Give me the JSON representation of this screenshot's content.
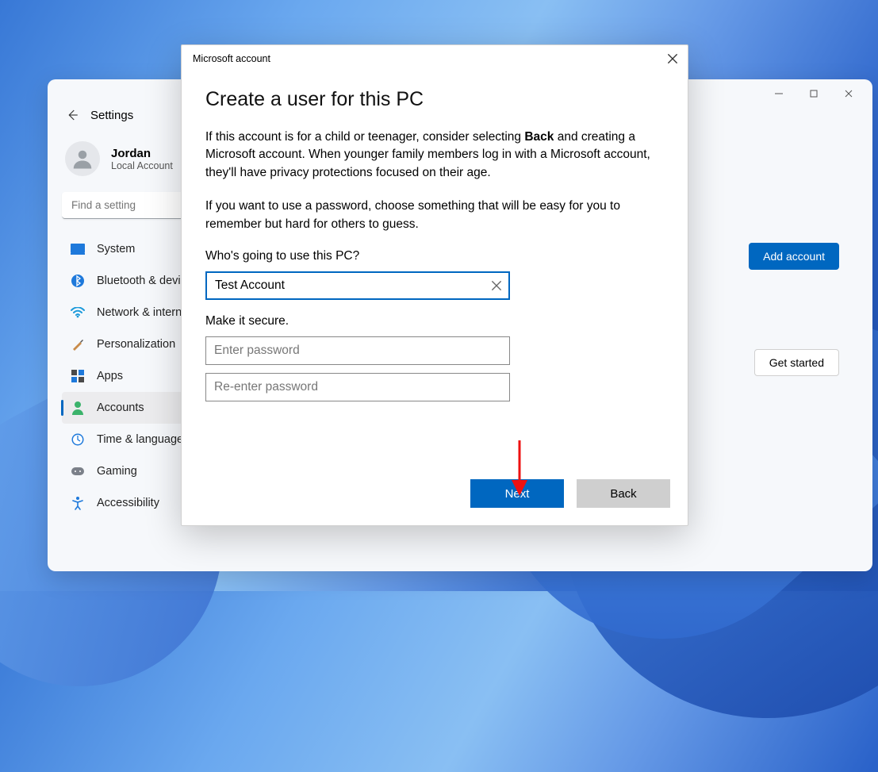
{
  "settings": {
    "header_label": "Settings",
    "user_name": "Jordan",
    "user_sub": "Local Account",
    "search_placeholder": "Find a setting",
    "nav": {
      "system": "System",
      "bluetooth": "Bluetooth & devices",
      "network": "Network & internet",
      "personalization": "Personalization",
      "apps": "Apps",
      "accounts": "Accounts",
      "time": "Time & language",
      "gaming": "Gaming",
      "accessibility": "Accessibility"
    },
    "buttons": {
      "add_account": "Add account",
      "get_started": "Get started"
    }
  },
  "dialog": {
    "window_title": "Microsoft account",
    "heading": "Create a user for this PC",
    "para1_pre": "If this account is for a child or teenager, consider selecting ",
    "para1_bold": "Back",
    "para1_post": " and creating a Microsoft account. When younger family members log in with a Microsoft account, they'll have privacy protections focused on their age.",
    "para2": "If you want to use a password, choose something that will be easy for you to remember but hard for others to guess.",
    "who_label": "Who's going to use this PC?",
    "username_value": "Test Account",
    "secure_label": "Make it secure.",
    "pw_placeholder": "Enter password",
    "pw2_placeholder": "Re-enter password",
    "next": "Next",
    "back": "Back"
  }
}
